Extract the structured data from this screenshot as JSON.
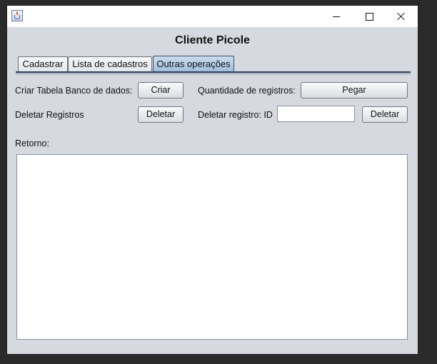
{
  "window": {
    "title": "",
    "app_icon": "java-cup-icon"
  },
  "titlebar_buttons": {
    "minimize_icon": "minimize-icon",
    "maximize_icon": "maximize-icon",
    "close_icon": "close-icon"
  },
  "header": {
    "title": "Cliente Picole"
  },
  "tabs": [
    {
      "label": "Cadastrar",
      "active": false
    },
    {
      "label": "Lista de cadastros",
      "active": false
    },
    {
      "label": "Outras operações",
      "active": true
    }
  ],
  "operations": {
    "create_table_label": "Criar Tabela Banco de dados:",
    "create_button": "Criar",
    "record_count_label": "Quantidade de registros:",
    "get_button": "Pegar",
    "delete_records_label": "Deletar Registros",
    "delete_all_button": "Deletar",
    "delete_id_label": "Deletar registro: ID",
    "delete_id_value": "",
    "delete_id_button": "Deletar",
    "return_label": "Retorno:",
    "return_text": ""
  },
  "colors": {
    "window_bg": "#d6d9e0",
    "active_tab": "#9fbedc",
    "tab_separator": "#2e3d57"
  }
}
